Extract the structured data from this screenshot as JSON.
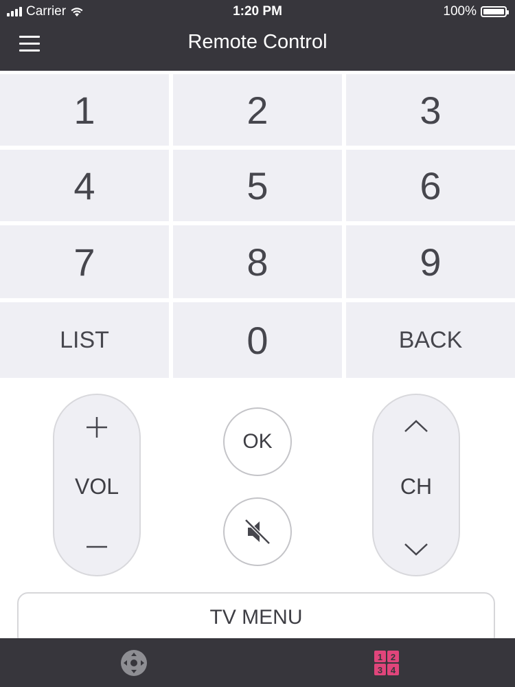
{
  "status_bar": {
    "carrier": "Carrier",
    "time": "1:20 PM",
    "battery": "100%"
  },
  "header": {
    "title": "Remote Control",
    "menu_icon": "hamburger-menu-icon"
  },
  "keypad": {
    "keys": [
      {
        "label": "1"
      },
      {
        "label": "2"
      },
      {
        "label": "3"
      },
      {
        "label": "4"
      },
      {
        "label": "5"
      },
      {
        "label": "6"
      },
      {
        "label": "7"
      },
      {
        "label": "8"
      },
      {
        "label": "9"
      },
      {
        "label": "LIST"
      },
      {
        "label": "0"
      },
      {
        "label": "BACK"
      }
    ]
  },
  "volume": {
    "label": "VOL",
    "up_icon": "plus-icon",
    "down_icon": "minus-icon"
  },
  "channel": {
    "label": "CH",
    "up_icon": "chevron-up-icon",
    "down_icon": "chevron-down-icon"
  },
  "ok_label": "OK",
  "mute_icon": "mute-speaker-icon",
  "tv_menu_label": "TV MENU",
  "tabbar": {
    "tabs": [
      {
        "icon": "dpad-icon",
        "active": false
      },
      {
        "icon": "numpad-icon",
        "active": true,
        "digits": [
          "1",
          "2",
          "3",
          "4"
        ]
      }
    ],
    "active_color": "#e0457b",
    "inactive_color": "#8e8e93"
  },
  "colors": {
    "bar_background": "#37363c",
    "key_background": "#efeff4",
    "text": "#3e3e44"
  }
}
